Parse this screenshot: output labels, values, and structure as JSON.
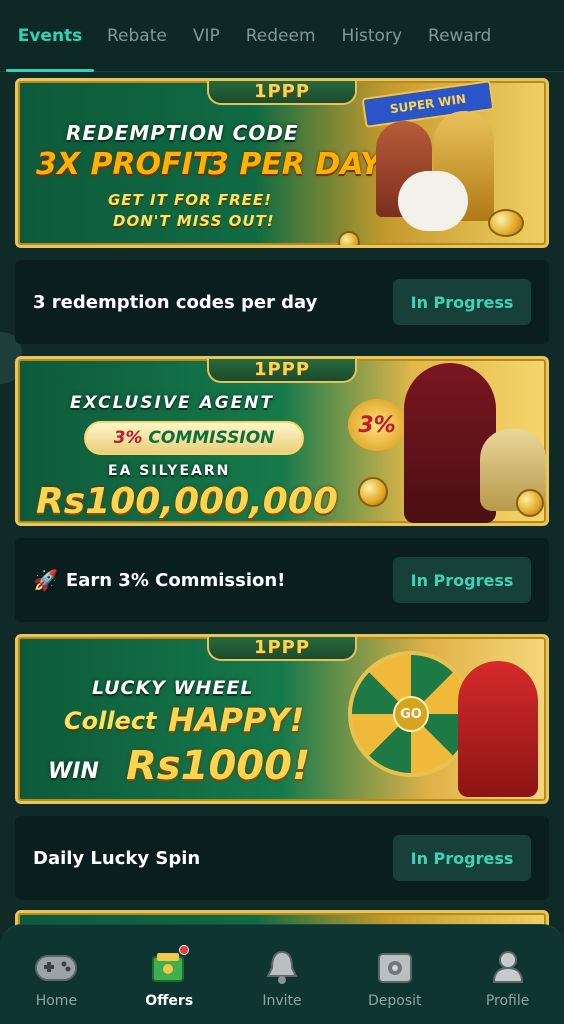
{
  "tabs": [
    "Events",
    "Rebate",
    "VIP",
    "Redeem",
    "History",
    "Reward"
  ],
  "active_tab": "Events",
  "events": [
    {
      "banner": {
        "logo": "1PPP",
        "line1": "REDEMPTION CODE",
        "line2a": "3X PROFIT",
        "line2b": "3 PER DAY",
        "line3": "GET IT FOR FREE!",
        "line4": "DON'T MISS OUT!",
        "art_text": "SUPER WIN"
      },
      "title": "3 redemption codes per day",
      "status": "In Progress"
    },
    {
      "banner": {
        "logo": "1PPP",
        "line1": "EXCLUSIVE AGENT",
        "pill_a": "3%",
        "pill_b": "COMMISSION",
        "line3": "EA SILYEARN",
        "line4": "Rs100,000,000",
        "art_text": "3%"
      },
      "title": "Earn 3% Commission!",
      "status": "In Progress"
    },
    {
      "banner": {
        "logo": "1PPP",
        "line1": "LUCKY WHEEL",
        "line2a": "Collect",
        "line2b": "HAPPY!",
        "line3a": "WIN",
        "line3b": "Rs1000!",
        "wheel_center": "GO"
      },
      "title": "Daily Lucky Spin",
      "status": "In Progress"
    }
  ],
  "nav": [
    {
      "label": "Home",
      "icon": "gamepad-icon"
    },
    {
      "label": "Offers",
      "icon": "offers-icon"
    },
    {
      "label": "Invite",
      "icon": "bell-icon"
    },
    {
      "label": "Deposit",
      "icon": "safe-icon"
    },
    {
      "label": "Profile",
      "icon": "profile-icon"
    }
  ],
  "active_nav": "Offers",
  "colors": {
    "accent": "#2fd3b8",
    "background": "#0f2a27",
    "card": "#0a1f1d",
    "button": "#17403b"
  }
}
